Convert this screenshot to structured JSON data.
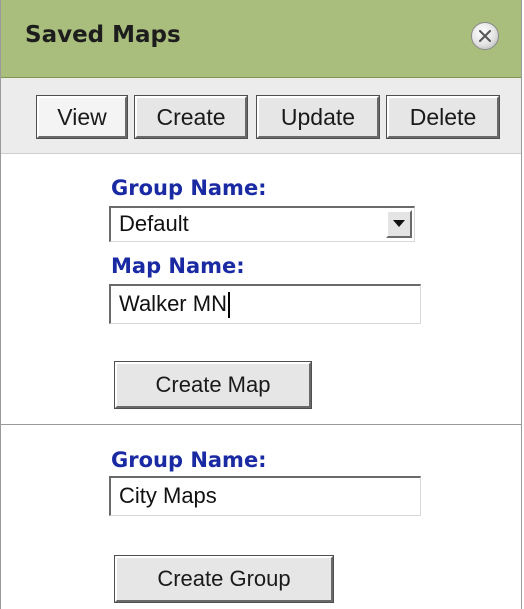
{
  "panel": {
    "title": "Saved Maps",
    "close_icon": "close-circle-icon"
  },
  "tabs": [
    {
      "label": "View",
      "active": true
    },
    {
      "label": "Create",
      "active": false
    },
    {
      "label": "Update",
      "active": false
    },
    {
      "label": "Delete",
      "active": false
    }
  ],
  "create_map": {
    "group_label": "Group Name:",
    "group_selected": "Default",
    "map_label": "Map Name:",
    "map_value": "Walker MN",
    "button_label": "Create Map"
  },
  "create_group": {
    "group_label": "Group Name:",
    "group_value": "City Maps",
    "button_label": "Create Group"
  },
  "colors": {
    "titlebar": "#a9bd7d",
    "label_blue": "#1a2aa3"
  }
}
